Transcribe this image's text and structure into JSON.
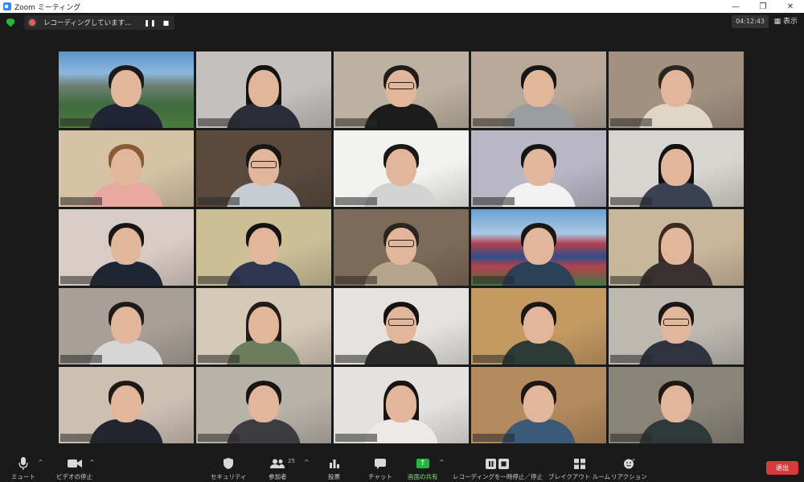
{
  "window": {
    "title": "Zoom ミーティング",
    "minimize": "—",
    "restore": "❐",
    "close": "✕"
  },
  "topbar": {
    "recording_text": "レコーディングしています...",
    "pause_glyph": "❚❚",
    "stop_glyph": "■",
    "timer": "04:12:43",
    "view_label": "表示",
    "view_icon": "grid-icon"
  },
  "participants": [
    {
      "bg": "#6fa0d0",
      "shirt": "#1f2535",
      "hair": "#1c1a18",
      "active": true,
      "glasses": false,
      "long": false,
      "scene": "city"
    },
    {
      "bg": "#c3c0bd",
      "shirt": "#2a2d38",
      "hair": "#151312",
      "long": true
    },
    {
      "bg": "#bdb2a1",
      "shirt": "#1b1b1b",
      "hair": "#221d1a",
      "glasses": true
    },
    {
      "bg": "#b7a89a",
      "shirt": "#9a9ca0",
      "hair": "#181615"
    },
    {
      "bg": "#a29181",
      "shirt": "#e0d6c5",
      "hair": "#2b2520"
    },
    {
      "bg": "#d6c3a6",
      "shirt": "#e9a7a2",
      "hair": "#8a5a33"
    },
    {
      "bg": "#5a4a3e",
      "shirt": "#c7ccd4",
      "hair": "#191614",
      "glasses": true
    },
    {
      "bg": "#f2f2f0",
      "shirt": "#d2d2d2",
      "hair": "#1a1817"
    },
    {
      "bg": "#b9b7c6",
      "shirt": "#f2f2f2",
      "hair": "#161412"
    },
    {
      "bg": "#d8d5d0",
      "shirt": "#3a4150",
      "hair": "#141210",
      "long": true
    },
    {
      "bg": "#d9cbc5",
      "shirt": "#1e2533",
      "hair": "#191715"
    },
    {
      "bg": "#cbbf98",
      "shirt": "#2c3650",
      "hair": "#151312"
    },
    {
      "bg": "#7d6b5a",
      "shirt": "#b5a58d",
      "hair": "#2a2420",
      "glasses": true
    },
    {
      "bg": "#8bb3d7",
      "shirt": "#2a4158",
      "hair": "#1a1614",
      "scene": "stadium"
    },
    {
      "bg": "#c9b79c",
      "shirt": "#3a3030",
      "hair": "#3b2a22",
      "long": true
    },
    {
      "bg": "#a8a098",
      "shirt": "#d6d6d6",
      "hair": "#1d1a18"
    },
    {
      "bg": "#d5c9b7",
      "shirt": "#6c7d5e",
      "hair": "#211c18",
      "long": true
    },
    {
      "bg": "#e5e3e0",
      "shirt": "#2b2b2b",
      "hair": "#141210",
      "glasses": true
    },
    {
      "bg": "#c49a62",
      "shirt": "#2c3b35",
      "hair": "#1b1715"
    },
    {
      "bg": "#bdb8b0",
      "shirt": "#2f3340",
      "hair": "#1a1716",
      "glasses": true
    },
    {
      "bg": "#cdbfb2",
      "shirt": "#22252d",
      "hair": "#1c1816"
    },
    {
      "bg": "#b9b2a9",
      "shirt": "#3c3c40",
      "hair": "#181513"
    },
    {
      "bg": "#e4e2e0",
      "shirt": "#ece9e6",
      "hair": "#161312",
      "long": true
    },
    {
      "bg": "#b48a5e",
      "shirt": "#3b5a78",
      "hair": "#1d1816"
    },
    {
      "bg": "#8a8378",
      "shirt": "#2e3a3a",
      "hair": "#1a1715"
    }
  ],
  "toolbar": {
    "mute": "ミュート",
    "video": "ビデオの停止",
    "security": "セキュリティ",
    "participants": "参加者",
    "participants_count": "25",
    "polls": "投票",
    "chat": "チャット",
    "share": "画面の共有",
    "recording": "レコーディングを一時停止／停止",
    "breakout": "ブレイクアウト ルーム",
    "reactions": "リアクション",
    "leave": "退出",
    "caret": "^"
  },
  "colors": {
    "accent_green": "#27b53e",
    "active_border": "#cde77a",
    "leave_red": "#d73a3a"
  }
}
